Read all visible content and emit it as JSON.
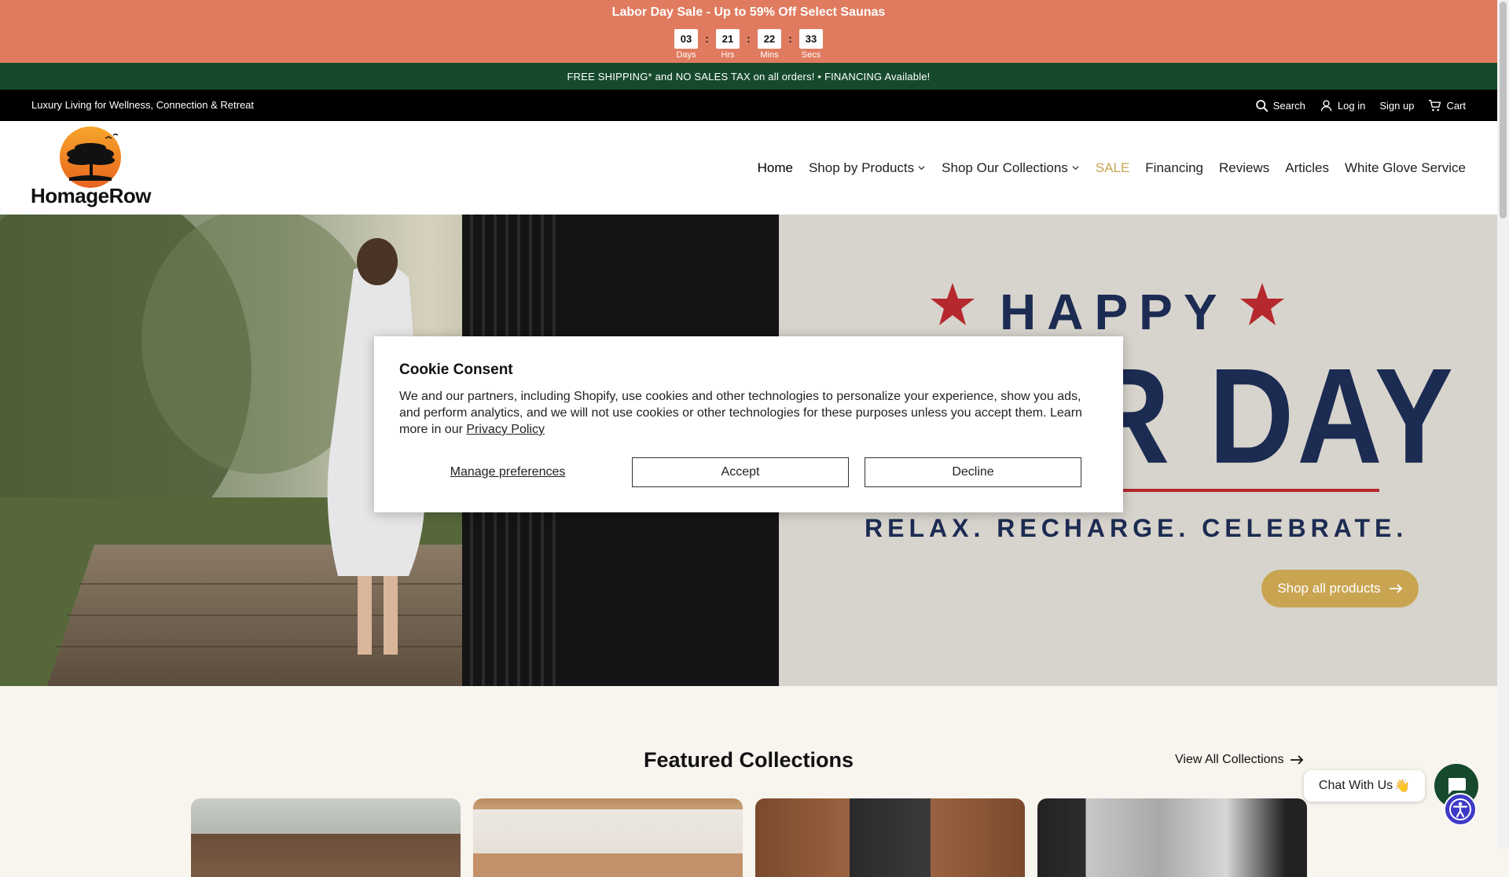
{
  "promo": {
    "title": "Labor Day Sale - Up to 59% Off Select Saunas",
    "countdown": [
      {
        "value": "03",
        "label": "Days"
      },
      {
        "value": "21",
        "label": "Hrs"
      },
      {
        "value": "22",
        "label": "Mins"
      },
      {
        "value": "33",
        "label": "Secs"
      }
    ],
    "separator": ":"
  },
  "shipping": {
    "text": "FREE SHIPPING* and NO SALES TAX on all orders!  • FINANCING Available!"
  },
  "utility": {
    "tagline": "Luxury Living for Wellness, Connection & Retreat",
    "search": "Search",
    "login": "Log in",
    "signup": "Sign up",
    "cart": "Cart"
  },
  "brand": {
    "name": "HomageRow"
  },
  "nav": {
    "home": "Home",
    "shop_products": "Shop by Products",
    "shop_collections": "Shop Our Collections",
    "sale": "SALE",
    "financing": "Financing",
    "reviews": "Reviews",
    "articles": "Articles",
    "white_glove": "White Glove Service"
  },
  "hero": {
    "happy": "HAPPY",
    "big": "R DAY",
    "tagline": "RELAX. RECHARGE. CELEBRATE.",
    "cta": "Shop all products"
  },
  "featured": {
    "title": "Featured Collections",
    "view_all": "View All Collections"
  },
  "cookie": {
    "title": "Cookie Consent",
    "body": "We and our partners, including Shopify, use cookies and other technologies to personalize your experience, show you ads, and perform analytics, and we will not use cookies or other technologies for these purposes unless you accept them. Learn more in our ",
    "link": "Privacy Policy",
    "manage": "Manage preferences",
    "accept": "Accept",
    "decline": "Decline"
  },
  "chat": {
    "label": "Chat With Us",
    "emoji": "👋"
  },
  "colors": {
    "promo_bg": "#e07b5f",
    "shipping_bg": "#164a2c",
    "accent_gold": "#c9a552",
    "navy": "#1c2b52",
    "red": "#b5282d"
  }
}
